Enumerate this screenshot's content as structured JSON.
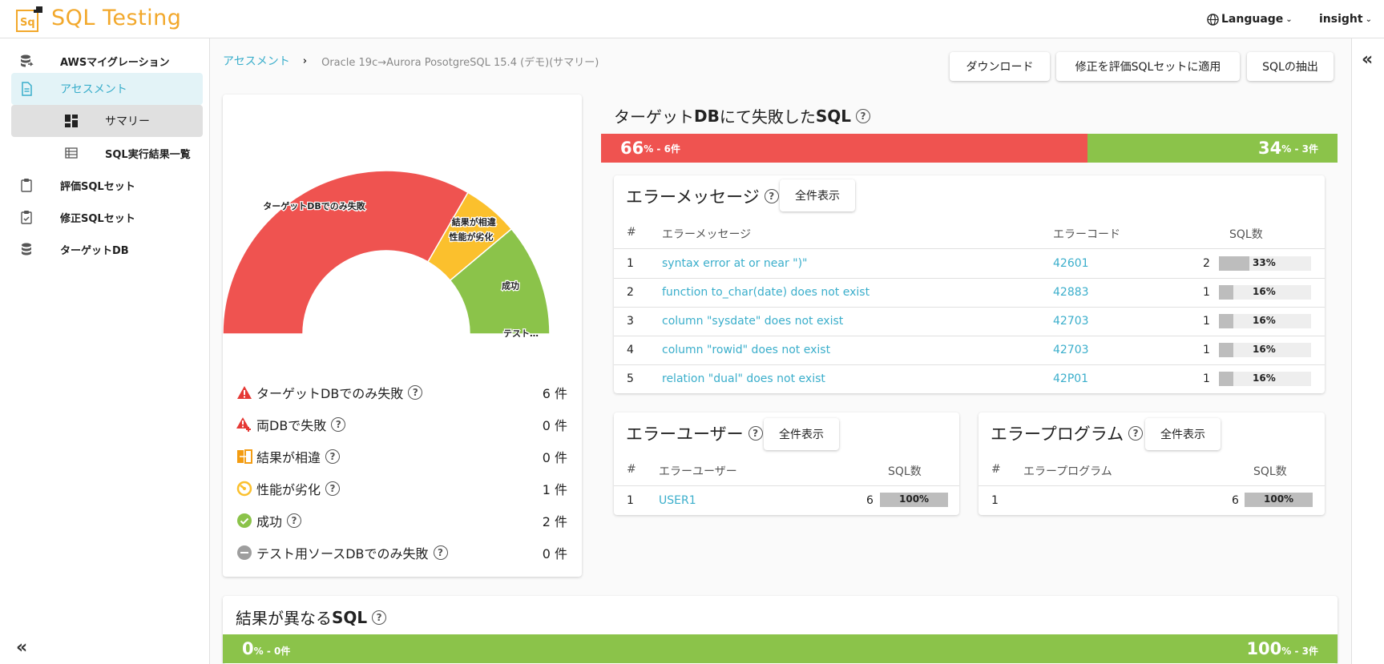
{
  "app": {
    "title": "SQL Testing",
    "logo_text": "Sq"
  },
  "header": {
    "language_label": "Language",
    "user_label": "insight"
  },
  "sidebar": {
    "items": [
      {
        "label": "AWSマイグレーション",
        "icon": "cloud-migration-icon"
      },
      {
        "label": "アセスメント",
        "icon": "document-icon",
        "active": true
      },
      {
        "label": "サマリー",
        "icon": "dashboard-icon",
        "sub": true,
        "selected": true
      },
      {
        "label": "SQL実行結果一覧",
        "icon": "table-list-icon",
        "sub": true
      },
      {
        "label": "評価SQLセット",
        "icon": "clipboard-icon"
      },
      {
        "label": "修正SQLセット",
        "icon": "clipboard-check-icon"
      },
      {
        "label": "ターゲットDB",
        "icon": "database-icon"
      }
    ],
    "collapse_label": "«"
  },
  "rightbar": {
    "collapse_label": "«"
  },
  "breadcrumb": {
    "root": "アセスメント",
    "separator": "›",
    "current": "Oracle 19c→Aurora PosotgreSQL 15.4 (デモ)(サマリー)"
  },
  "actions": {
    "download": "ダウンロード",
    "apply_fix": "修正を評価SQLセットに適用",
    "extract": "SQLの抽出"
  },
  "summary": {
    "chart_data": {
      "type": "pie",
      "shape": "half-donut",
      "slices": [
        {
          "label": "ターゲットDBでのみ失敗",
          "value": 6,
          "color": "#ef5350"
        },
        {
          "label": "結果が相違",
          "value": 0,
          "color": "#fbc02d"
        },
        {
          "label": "性能が劣化",
          "value": 1,
          "color": "#fbc02d"
        },
        {
          "label": "成功",
          "value": 2,
          "color": "#8bc34a"
        },
        {
          "label": "テスト…",
          "value": 0,
          "color": "#bdbdbd"
        }
      ],
      "chart_labels": [
        "ターゲットDBでのみ失敗",
        "結果が相違",
        "性能が劣化",
        "成功",
        "テスト…"
      ]
    },
    "legend": [
      {
        "label": "ターゲットDBでのみ失敗",
        "count": "6 件",
        "icon": "warning-icon",
        "color": "#e53935"
      },
      {
        "label": "両DBで失敗",
        "count": "0 件",
        "icon": "warning-plus-icon",
        "color": "#e53935"
      },
      {
        "label": "結果が相違",
        "count": "0 件",
        "icon": "diff-icon",
        "color": "#f39c12"
      },
      {
        "label": "性能が劣化",
        "count": "1 件",
        "icon": "speedometer-icon",
        "color": "#fbc02d"
      },
      {
        "label": "成功",
        "count": "2 件",
        "icon": "check-circle-icon",
        "color": "#8bc34a"
      },
      {
        "label": "テスト用ソースDBでのみ失敗",
        "count": "0 件",
        "icon": "minus-circle-icon",
        "color": "#9e9e9e"
      }
    ]
  },
  "failed": {
    "title_prefix": "ターゲット",
    "title_db": "DB",
    "title_mid": "にて失敗した",
    "title_sql": "SQL",
    "fail_percent": 66,
    "fail_pct_label": "66",
    "fail_suffix": "% - 6件",
    "pass_percent": 34,
    "pass_pct_label": "34",
    "pass_suffix": "% - 3件",
    "fail_color": "#ef5350",
    "pass_color": "#8bc34a"
  },
  "error_messages": {
    "title": "エラーメッセージ",
    "show_all": "全件表示",
    "headers": [
      "#",
      "エラーメッセージ",
      "エラーコード",
      "SQL数"
    ],
    "rows": [
      {
        "n": "1",
        "message": "syntax error at or near \")\"",
        "code": "42601",
        "count": "2",
        "pct_value": 33,
        "pct": "33%"
      },
      {
        "n": "2",
        "message": "function to_char(date) does not exist",
        "code": "42883",
        "count": "1",
        "pct_value": 16,
        "pct": "16%"
      },
      {
        "n": "3",
        "message": "column \"sysdate\" does not exist",
        "code": "42703",
        "count": "1",
        "pct_value": 16,
        "pct": "16%"
      },
      {
        "n": "4",
        "message": "column \"rowid\" does not exist",
        "code": "42703",
        "count": "1",
        "pct_value": 16,
        "pct": "16%"
      },
      {
        "n": "5",
        "message": "relation \"dual\" does not exist",
        "code": "42P01",
        "count": "1",
        "pct_value": 16,
        "pct": "16%"
      }
    ]
  },
  "error_users": {
    "title": "エラーユーザー",
    "show_all": "全件表示",
    "headers": [
      "#",
      "エラーユーザー",
      "SQL数"
    ],
    "rows": [
      {
        "n": "1",
        "user": "USER1",
        "count": "6",
        "pct_value": 100,
        "pct": "100%"
      }
    ]
  },
  "error_programs": {
    "title": "エラープログラム",
    "show_all": "全件表示",
    "headers": [
      "#",
      "エラープログラム",
      "SQL数"
    ],
    "rows": [
      {
        "n": "1",
        "program": "",
        "count": "6",
        "pct_value": 100,
        "pct": "100%"
      }
    ]
  },
  "diff_sql": {
    "title_main": "結果が異なる",
    "title_sql": "SQL",
    "fail_percent": 0,
    "fail_pct_label": "0",
    "fail_suffix": "% - 0件",
    "pass_percent": 100,
    "pass_pct_label": "100",
    "pass_suffix": "% - 3件"
  }
}
